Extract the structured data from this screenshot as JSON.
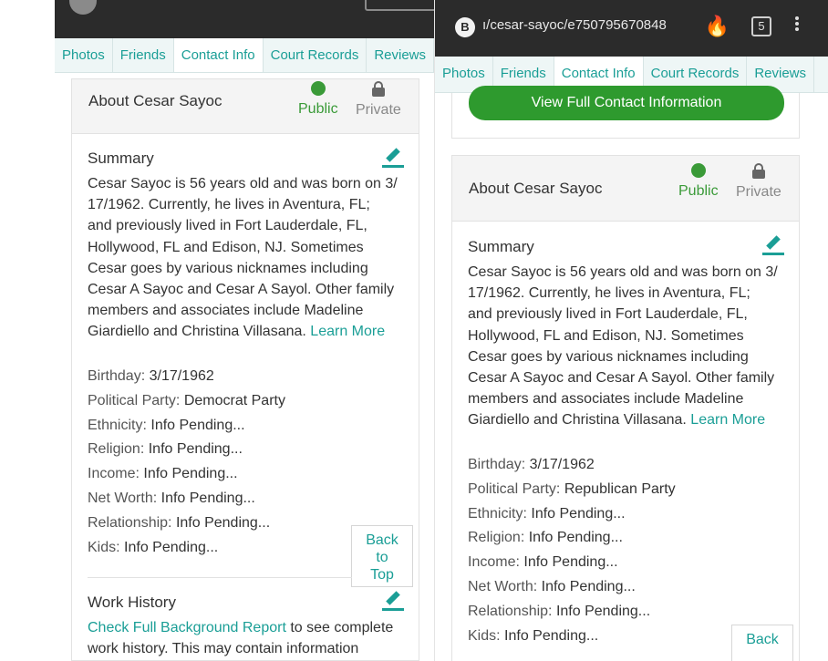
{
  "left": {
    "browser": {
      "url": ""
    },
    "tabs": [
      "Photos",
      "Friends",
      "Contact Info",
      "Court Records",
      "Reviews"
    ],
    "about": {
      "title": "About Cesar Sayoc",
      "public": "Public",
      "private": "Private"
    },
    "summary": {
      "title": "Summary",
      "lines": [
        "Cesar Sayoc is 56 years old and was born on 3/",
        "17/1962. Currently, he lives in Aventura, FL;",
        "and previously lived in Fort Lauderdale, FL,",
        "Hollywood, FL and Edison, NJ. Sometimes",
        "Cesar goes by various nicknames including",
        "Cesar A Sayoc and Cesar A Sayol. Other family",
        "members and associates include Madeline",
        "Giardiello and Christina Villasana."
      ],
      "learn_more": "Learn More"
    },
    "facts": [
      {
        "k": "Birthday:",
        "v": "3/17/1962"
      },
      {
        "k": "Political Party:",
        "v": "Democrat Party"
      },
      {
        "k": "Ethnicity:",
        "v": "Info Pending..."
      },
      {
        "k": "Religion:",
        "v": "Info Pending..."
      },
      {
        "k": "Income:",
        "v": "Info Pending..."
      },
      {
        "k": "Net Worth:",
        "v": "Info Pending..."
      },
      {
        "k": "Relationship:",
        "v": "Info Pending..."
      },
      {
        "k": "Kids:",
        "v": "Info Pending..."
      }
    ],
    "back_to_top": [
      "Back",
      "to",
      "Top"
    ],
    "work": {
      "title": "Work History",
      "link": "Check Full Background Report",
      "rest": " to see complete",
      "line2": "work history. This may contain information"
    }
  },
  "right": {
    "browser": {
      "icon": "B",
      "url": "ı/cesar-sayoc/e750795670848",
      "tabs_count": "5"
    },
    "tabs": [
      "Photos",
      "Friends",
      "Contact Info",
      "Court Records",
      "Reviews"
    ],
    "contact_button": "View Full Contact Information",
    "about": {
      "title": "About Cesar Sayoc",
      "public": "Public",
      "private": "Private"
    },
    "summary": {
      "title": "Summary",
      "lines": [
        "Cesar Sayoc is 56 years old and was born on 3/",
        "17/1962. Currently, he lives in Aventura, FL;",
        "and previously lived in Fort Lauderdale, FL,",
        "Hollywood, FL and Edison, NJ. Sometimes",
        "Cesar goes by various nicknames including",
        "Cesar A Sayoc and Cesar A Sayol. Other family",
        "members and associates include Madeline",
        "Giardiello and Christina Villasana."
      ],
      "learn_more": "Learn More"
    },
    "facts": [
      {
        "k": "Birthday:",
        "v": "3/17/1962"
      },
      {
        "k": "Political Party:",
        "v": "Republican Party"
      },
      {
        "k": "Ethnicity:",
        "v": "Info Pending..."
      },
      {
        "k": "Religion:",
        "v": "Info Pending..."
      },
      {
        "k": "Income:",
        "v": "Info Pending..."
      },
      {
        "k": "Net Worth:",
        "v": "Info Pending..."
      },
      {
        "k": "Relationship:",
        "v": "Info Pending..."
      },
      {
        "k": "Kids:",
        "v": "Info Pending..."
      }
    ],
    "back_label": "Back"
  },
  "colors": {
    "accent": "#1a9e96",
    "green_button": "#2e9a2e",
    "public_green": "#3a9a38",
    "toolbar": "#2b2b2b"
  },
  "icons": [
    "brave-icon",
    "flame-icon",
    "tabs-icon",
    "menu-icon",
    "globe-icon",
    "lock-icon",
    "pencil-icon"
  ]
}
